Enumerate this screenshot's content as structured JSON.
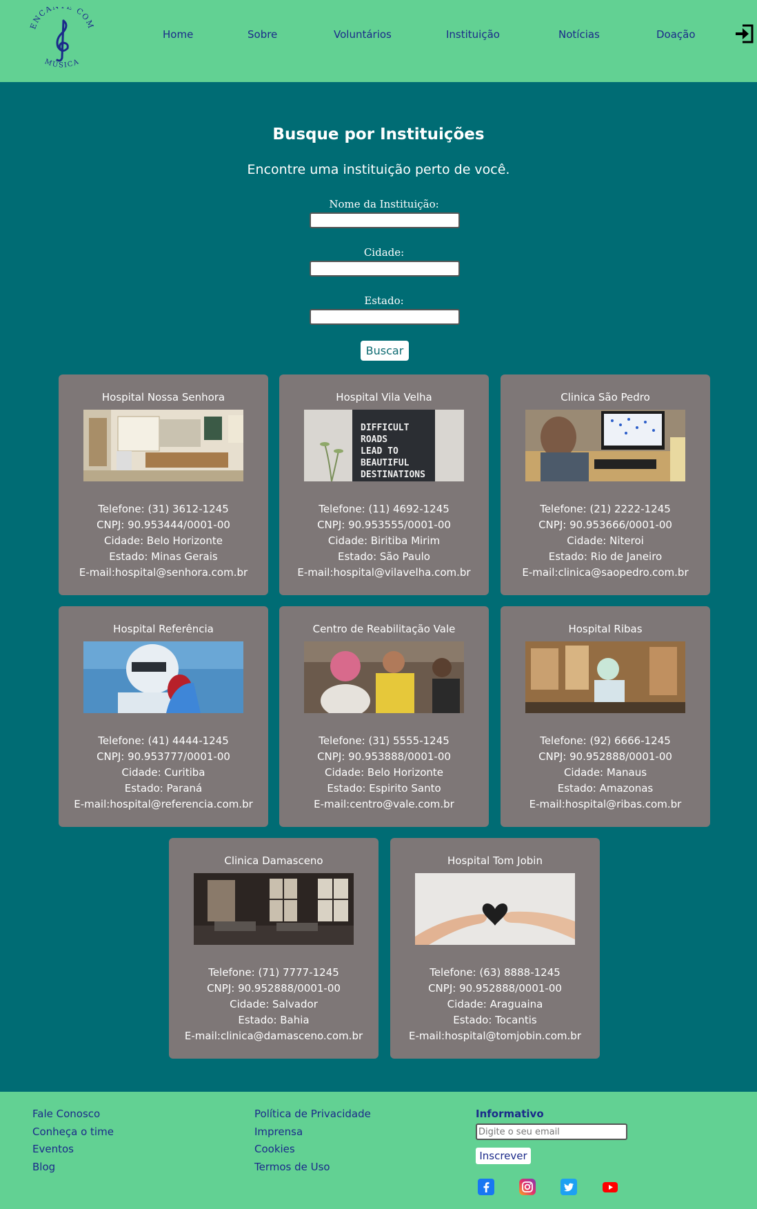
{
  "brand": {
    "logo_top": "ENCANTE COM",
    "logo_bottom": "MÚSICA"
  },
  "nav": {
    "items": [
      "Home",
      "Sobre",
      "Voluntários",
      "Instituição",
      "Notícias",
      "Doação"
    ]
  },
  "search": {
    "title": "Busque por Instituições",
    "subtitle": "Encontre uma instituição perto de você.",
    "name_label": "Nome da Instituição:",
    "city_label": "Cidade:",
    "state_label": "Estado:",
    "button": "Buscar"
  },
  "cards": [
    {
      "title": "Hospital Nossa Senhora",
      "phone": "Telefone: (31) 3612-1245",
      "cnpj": "CNPJ: 90.953444/0001-00",
      "city": "Cidade: Belo Horizonte",
      "state": "Estado: Minas Gerais",
      "email": "E-mail:hospital@senhora.com.br"
    },
    {
      "title": "Hospital Vila Velha",
      "phone": "Telefone: (11) 4692-1245",
      "cnpj": "CNPJ: 90.953555/0001-00",
      "city": "Cidade: Biritiba Mirim",
      "state": "Estado: São Paulo",
      "email": "E-mail:hospital@vilavelha.com.br",
      "sign": [
        "DIFFICULT",
        "ROADS",
        "LEAD TO",
        "BEAUTIFUL",
        "DESTINATIONS"
      ]
    },
    {
      "title": "Clinica São Pedro",
      "phone": "Telefone: (21) 2222-1245",
      "cnpj": "CNPJ: 90.953666/0001-00",
      "city": "Cidade: Niteroi",
      "state": "Estado: Rio de Janeiro",
      "email": "E-mail:clinica@saopedro.com.br"
    },
    {
      "title": "Hospital Referência",
      "phone": "Telefone: (41) 4444-1245",
      "cnpj": "CNPJ: 90.953777/0001-00",
      "city": "Cidade: Curitiba",
      "state": "Estado: Paraná",
      "email": "E-mail:hospital@referencia.com.br"
    },
    {
      "title": "Centro de Reabilitação Vale",
      "phone": "Telefone: (31) 5555-1245",
      "cnpj": "CNPJ: 90.953888/0001-00",
      "city": "Cidade: Belo Horizonte",
      "state": "Estado: Espirito Santo",
      "email": "E-mail:centro@vale.com.br"
    },
    {
      "title": "Hospital Ribas",
      "phone": "Telefone: (92) 6666-1245",
      "cnpj": "CNPJ: 90.952888/0001-00",
      "city": "Cidade: Manaus",
      "state": "Estado: Amazonas",
      "email": "E-mail:hospital@ribas.com.br"
    },
    {
      "title": "Clinica Damasceno",
      "phone": "Telefone: (71) 7777-1245",
      "cnpj": "CNPJ: 90.952888/0001-00",
      "city": "Cidade: Salvador",
      "state": "Estado: Bahia",
      "email": "E-mail:clinica@damasceno.com.br"
    },
    {
      "title": "Hospital Tom Jobin",
      "phone": "Telefone: (63) 8888-1245",
      "cnpj": "CNPJ: 90.952888/0001-00",
      "city": "Cidade: Araguaina",
      "state": "Estado: Tocantis",
      "email": "E-mail:hospital@tomjobin.com.br"
    }
  ],
  "footer": {
    "col1": [
      "Fale Conosco",
      "Conheça o time",
      "Eventos",
      "Blog"
    ],
    "col2": [
      "Política de Privacidade",
      "Imprensa",
      "Cookies",
      "Termos de Uso"
    ],
    "newsletter_title": "Informativo",
    "newsletter_placeholder": "Digite o seu email",
    "newsletter_button": "Inscrever",
    "social": [
      "facebook-icon",
      "instagram-icon",
      "twitter-icon",
      "youtube-icon"
    ]
  },
  "colors": {
    "header_bg": "#62d193",
    "page_bg": "#006c74",
    "card_bg": "#7e7777",
    "nav_text": "#1b2a8a"
  }
}
